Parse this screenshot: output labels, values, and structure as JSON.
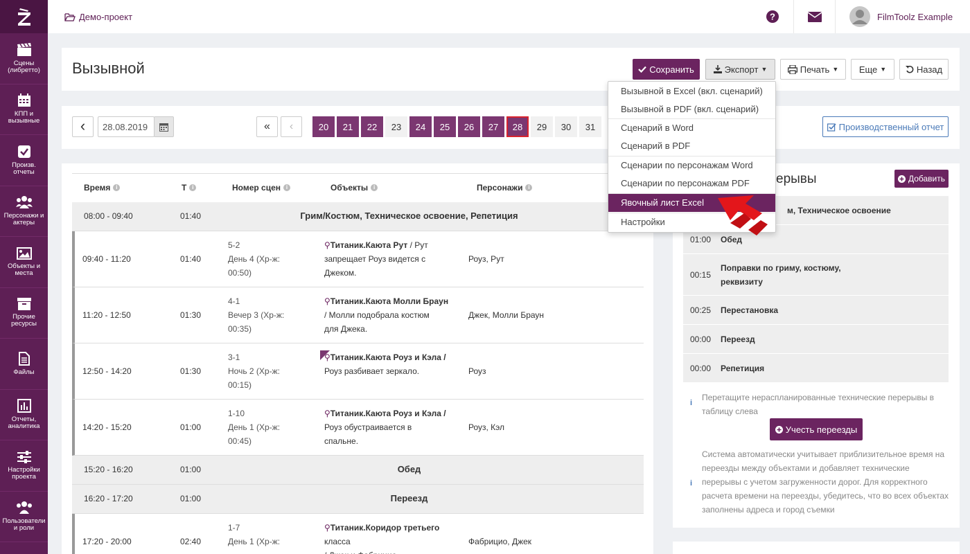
{
  "brand_colors": {
    "primary": "#5e1f55",
    "button": "#6b2460",
    "accent_red": "#d9232e"
  },
  "sidebar": {
    "items": [
      {
        "label": "Сцены (либретто)",
        "icon": "clapperboard-icon"
      },
      {
        "label": "КПП и вызывные",
        "icon": "calendar-icon"
      },
      {
        "label": "Произв. отчеты",
        "icon": "checkbox-icon"
      },
      {
        "label": "Персонажи и актеры",
        "icon": "users-icon"
      },
      {
        "label": "Объекты и места",
        "icon": "image-icon"
      },
      {
        "label": "Прочие ресурсы",
        "icon": "archive-icon"
      },
      {
        "label": "Файлы",
        "icon": "file-icon"
      },
      {
        "label": "Отчеты, аналитика",
        "icon": "chart-icon"
      },
      {
        "label": "Настройки проекта",
        "icon": "sliders-icon"
      },
      {
        "label": "Пользователи и роли",
        "icon": "user-group-icon"
      }
    ]
  },
  "header": {
    "project": "Демо-проект",
    "user": "FilmToolz Example"
  },
  "page": {
    "title": "Вызывной"
  },
  "toolbar": {
    "save": "Сохранить",
    "export": "Экспорт",
    "print": "Печать",
    "more": "Еще",
    "back": "Назад"
  },
  "export_menu": {
    "items": [
      "Вызывной в Excel (вкл. сценарий)",
      "Вызывной в PDF (вкл. сценарий)",
      "Сценарий в Word",
      "Сценарий в PDF",
      "Сценарии по персонажам Word",
      "Сценарии по персонажам PDF",
      "Явочный лист Excel",
      "Настройки"
    ],
    "selected": "Явочный лист Excel"
  },
  "datenav": {
    "date": "28.08.2019",
    "first": "«",
    "prev": "‹",
    "days": [
      "20",
      "21",
      "22",
      "23",
      "24",
      "25",
      "26",
      "27",
      "28",
      "29",
      "30",
      "31"
    ],
    "active_days": [
      "20",
      "21",
      "22",
      "24",
      "25",
      "26",
      "27"
    ],
    "current": "28"
  },
  "prod_report": "Производственный отчет",
  "table": {
    "headers": [
      "Время",
      "Т",
      "Номер сцен",
      "Объекты",
      "Персонажи"
    ]
  },
  "schedule": [
    {
      "kind": "group",
      "time": "08:00 - 09:40",
      "dur": "01:40",
      "title": "Грим/Костюм, Техническое освоение, Репетиция"
    },
    {
      "kind": "scene",
      "time": "09:40 - 11:20",
      "dur": "01:40",
      "scene": "5-2",
      "day": "День 4 (Хр-ж:",
      "dur2": "00:50)",
      "obj": "Титаник.Каюта Рут",
      "desc1": "/ Рут",
      "desc2": "запрещает Роуз видется с",
      "desc3": "Джеком.",
      "chars": "Роуз, Рут"
    },
    {
      "kind": "scene",
      "time": "11:20 - 12:50",
      "dur": "01:30",
      "scene": "4-1",
      "day": "Вечер 3 (Хр-ж:",
      "dur2": "00:35)",
      "obj": "Титаник.Каюта Молли Браун",
      "desc1": "",
      "desc2": "/ Молли подобрала костюм",
      "desc3": "для Джека.",
      "chars": "Джек, Молли Браун"
    },
    {
      "kind": "scene",
      "time": "12:50 - 14:20",
      "dur": "01:30",
      "scene": "3-1",
      "day": "Ночь 2 (Хр-ж:",
      "dur2": "00:15)",
      "obj": "Титаник.Каюта Роуз и Кэла /",
      "desc1": "",
      "desc2": "Роуз разбивает зеркало.",
      "desc3": "",
      "chars": "Роуз"
    },
    {
      "kind": "scene",
      "time": "14:20 - 15:20",
      "dur": "01:00",
      "scene": "1-10",
      "day": "День 1 (Хр-ж:",
      "dur2": "00:45)",
      "obj": "Титаник.Каюта Роуз и Кэла /",
      "desc1": "",
      "desc2": "Роуз обустраивается в",
      "desc3": "спальне.",
      "chars": "Роуз, Кэл"
    },
    {
      "kind": "group",
      "time": "15:20 - 16:20",
      "dur": "01:00",
      "title": "Обед"
    },
    {
      "kind": "group",
      "time": "16:20 - 17:20",
      "dur": "01:00",
      "title": "Переезд"
    },
    {
      "kind": "scene",
      "time": "17:20 - 20:00",
      "dur": "02:40",
      "scene": "1-7",
      "day": "День 1 (Хр-ж:",
      "dur2": "",
      "obj": "Титаник.Коридор третьего",
      "desc1": "",
      "desc2": "класса",
      "desc3": "/ Джек и Фабрицио",
      "chars": "Фабрицио, Джек"
    }
  ],
  "breaks": {
    "title_tail": "ерывы",
    "add": "Добавить",
    "rows": [
      {
        "time": "",
        "name": "м, Техническое освоение"
      },
      {
        "time": "01:00",
        "name": "Обед"
      },
      {
        "time": "00:15",
        "name": "Поправки по гриму, костюму,",
        "name2": "реквизиту"
      },
      {
        "time": "00:25",
        "name": "Перестановка"
      },
      {
        "time": "00:00",
        "name": "Переезд"
      },
      {
        "time": "00:00",
        "name": "Репетиция"
      }
    ],
    "hint1a": "Перетащите нераспланированные технические перерывы в",
    "hint1b": "таблицу слева",
    "travel_btn": "Учесть переезды",
    "hint2": [
      "Система автоматически учитывает приблизительное время на",
      "переезды между объектами и добавляет технические",
      "перерывы с учетом загруженности дорог. Для корректного",
      "расчета времени на переезды, убедитесь, что во всех объектах",
      "заполнены адреса и город съемки"
    ]
  }
}
